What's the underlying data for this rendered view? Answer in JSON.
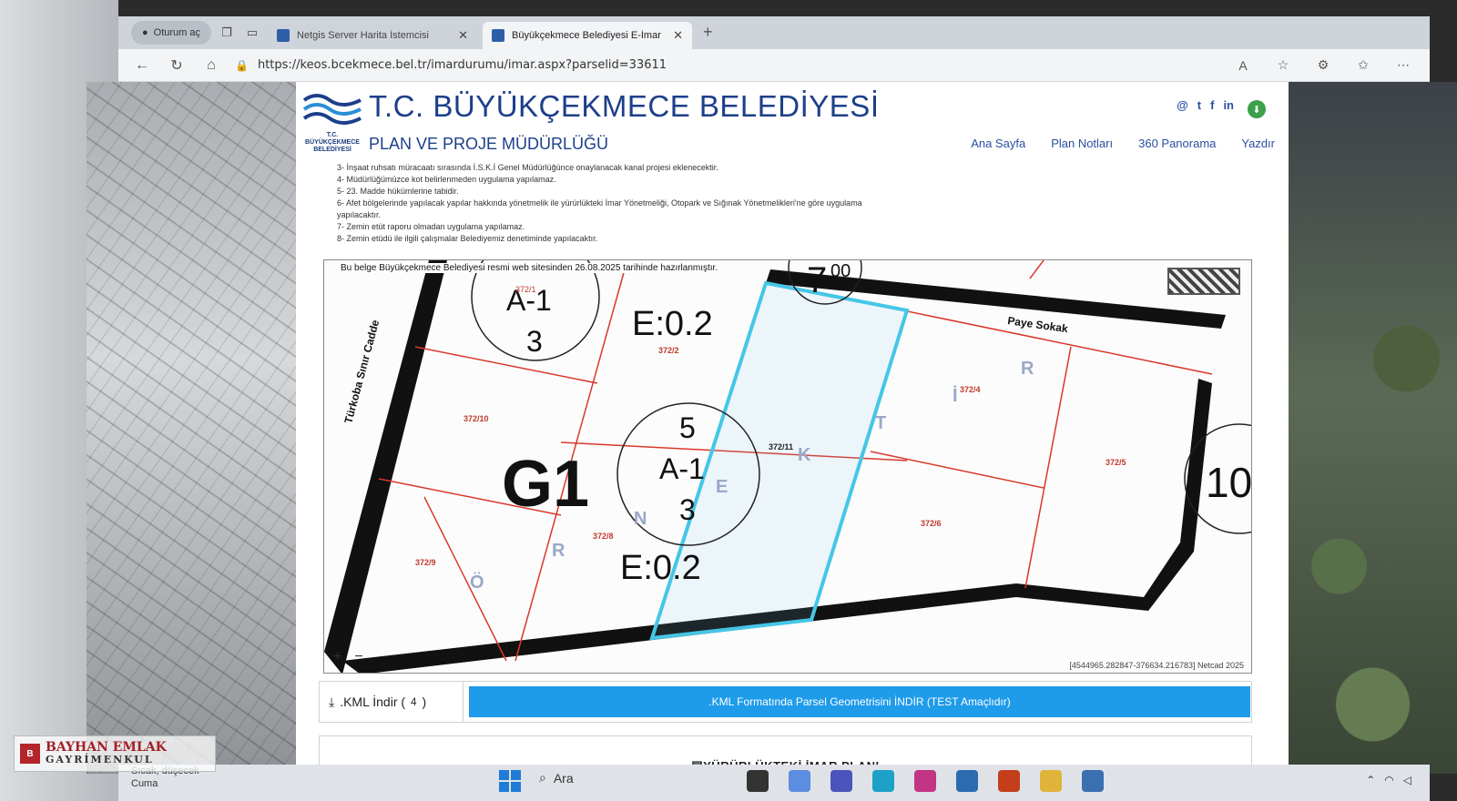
{
  "browser": {
    "profile_label": "Oturum aç",
    "tabs": [
      {
        "label": "Netgis Server Harita İstemcisi",
        "active": false
      },
      {
        "label": "Büyükçekmece Belediyesi E-İmar",
        "active": true
      }
    ],
    "url": "https://keos.bcekmece.bel.tr/imardurumu/imar.aspx?parselid=33611"
  },
  "header": {
    "logo_text": "T.C. BÜYÜKÇEKMECE BELEDİYESİ",
    "title": "T.C. BÜYÜKÇEKMECE BELEDİYESİ",
    "subtitle": "PLAN VE PROJE MÜDÜRLÜĞÜ",
    "social": [
      "@",
      "t",
      "f",
      "in"
    ],
    "nav": [
      "Ana Sayfa",
      "Plan Notları",
      "360 Panorama",
      "Yazdır"
    ]
  },
  "notes": [
    "3- İnşaat ruhsatı müracaatı sırasında İ.S.K.İ Genel Müdürlüğünce onaylanacak kanal projesi eklenecektir.",
    "4- Müdürlüğümüzce kot belirlenmeden uygulama yapılamaz.",
    "5- 23. Madde hükümlerine tabidir.",
    "6- Afet bölgelerinde yapılacak yapılar hakkında yönetmelik ile yürürlükteki İmar Yönetmeliği, Otopark ve Sığınak Yönetmelikleri'ne göre uygulama yapılacaktır.",
    "7- Zemin etüt raporu olmadan uygulama yapılamaz.",
    "8- Zemin etüdü ile ilgili çalışmalar Belediyemiz denetiminde yapılacaktır."
  ],
  "map": {
    "caption": "Bu belge Büyükçekmece Belediyesi resmi web sitesinden 26.08.2025 tarihinde hazırlanmıştır.",
    "coords": "[4544965.282847-376634.216783] Netcad 2025",
    "street_left": "Türkoba Sınır Cadde",
    "street_top": "Paye Sokak",
    "zone": "G1",
    "circle1": {
      "top": "A-1",
      "bottom": "3",
      "num": "372/1"
    },
    "circle2": {
      "top": "5",
      "mid": "A-1",
      "bottom": "3"
    },
    "circle3": "10",
    "height_label": "7",
    "height_sup": "00",
    "e_label_1": "E:0.2",
    "e_label_2": "E:0.2",
    "parcels": [
      "372/2",
      "372/10",
      "372/11",
      "372/4",
      "372/5",
      "372/6",
      "372/8",
      "372/9"
    ],
    "zoom_in": "+",
    "zoom_out": "−",
    "letters": [
      "Ö",
      "R",
      "N",
      "E",
      "K",
      "T",
      "İ",
      "R"
    ]
  },
  "kml": {
    "label": ".KML İndir (",
    "label_sup": "4",
    "label_end": ")",
    "button": ".KML Formatında Parsel Geometrisini İNDİR (TEST Amaçlıdır)"
  },
  "plan_header": "YÜRÜRLÜKTEKİ İMAR PLANI",
  "taskbar": {
    "weather": "Sıcak, düşecek",
    "weather_sub": "Cuma",
    "search": "Ara"
  },
  "watermark": {
    "line1": "BAYHAN EMLAK",
    "line2": "GAYRİMENKUL"
  }
}
